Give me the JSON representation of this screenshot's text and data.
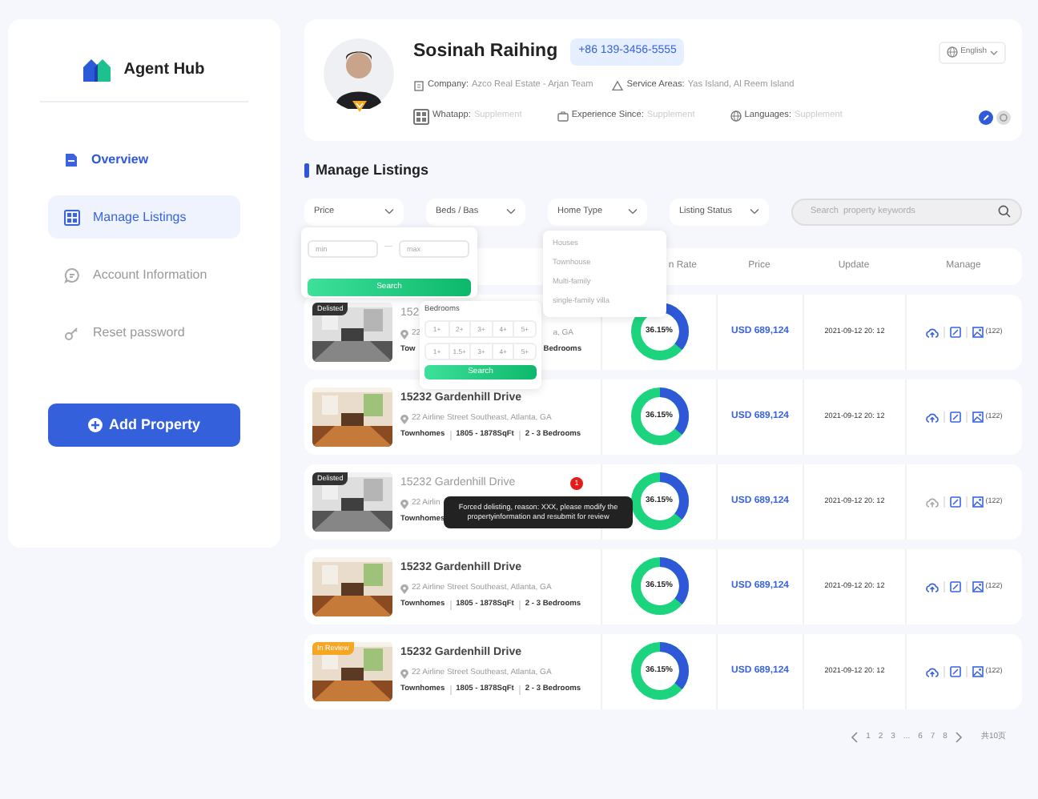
{
  "sidebar": {
    "logo": "Agent Hub",
    "items": [
      {
        "label": "Overview",
        "selected": false,
        "emphasized": true
      },
      {
        "label": "Manage Listings",
        "selected": true,
        "emphasized": false
      },
      {
        "label": "Account Information",
        "selected": false,
        "emphasized": false
      },
      {
        "label": "Reset password",
        "selected": false,
        "emphasized": false
      }
    ],
    "add_button": "Add Property"
  },
  "profile": {
    "name": "Sosinah Raihing",
    "phone": "+86 139-3456-5555",
    "language": "English",
    "fields": [
      {
        "label": "Company:",
        "value": "Azco Real Estate - Arjan Team",
        "filled": true
      },
      {
        "label": "Service Areas:",
        "value": "Yas Island, Al Reem Island",
        "filled": true
      },
      {
        "label": "Whatapp:",
        "value": "Supplement",
        "filled": false
      },
      {
        "label": "Experience Since:",
        "value": "Supplement",
        "filled": false
      },
      {
        "label": "Languages:",
        "value": "Supplement",
        "filled": false
      }
    ]
  },
  "section_title": "Manage Listings",
  "filters": [
    {
      "label": "Price"
    },
    {
      "label": "Beds / Bas"
    },
    {
      "label": "Home Type"
    },
    {
      "label": "Listing Status"
    }
  ],
  "search": {
    "placeholder": "Search  property keywords"
  },
  "price_popup": {
    "min_placeholder": "min",
    "separator": "—",
    "max_placeholder": "max",
    "button": "Search"
  },
  "beds_popup": {
    "title": "Bedrooms",
    "bedroom_options": [
      "1+",
      "2+",
      "3+",
      "4+",
      "5+"
    ],
    "bathroom_options": [
      "1+",
      "1.5+",
      "3+",
      "4+",
      "5+"
    ],
    "button": "Search"
  },
  "home_type_menu": [
    "Houses",
    "Townhouse",
    "Multi-family",
    "single-family villa"
  ],
  "table": {
    "columns": [
      "n Rate",
      "Price",
      "Update",
      "Manage"
    ],
    "rows": [
      {
        "status": {
          "kind": "delisted",
          "label": "Delisted"
        },
        "title": "152",
        "address": "22",
        "address_tail": "a, GA",
        "features": [
          "Tow"
        ],
        "features_tail": "Bedrooms",
        "rate": "36.15%",
        "level": 0.36,
        "price": "USD 689,124",
        "updated": "2021-09-12 20: 12",
        "count": "(122)",
        "upload_disabled": false
      },
      {
        "status": null,
        "title": "15232 Gardenhill Drive",
        "address": "22 Airline Street Southeast, Atlanta, GA",
        "features": [
          "Townhomes",
          "1805 - 1878SqFt",
          "2 - 3 Bedrooms"
        ],
        "rate": "36.15%",
        "level": 0.36,
        "price": "USD 689,124",
        "updated": "2021-09-12 20: 12",
        "count": "(122)",
        "upload_disabled": false
      },
      {
        "status": {
          "kind": "delisted",
          "label": "Delisted"
        },
        "title": "15232 Gardenhill Drive",
        "address": "22 Airlin",
        "features": [
          "Townhomes"
        ],
        "rate": "36.15%",
        "level": 0.36,
        "price": "USD 689,124",
        "updated": "2021-09-12 20: 12",
        "count": "(122)",
        "upload_disabled": true
      },
      {
        "status": null,
        "title": "15232 Gardenhill Drive",
        "address": "22 Airline Street Southeast, Atlanta, GA",
        "features": [
          "Townhomes",
          "1805 - 1878SqFt",
          "2 - 3 Bedrooms"
        ],
        "rate": "36.15%",
        "level": 0.36,
        "price": "USD 689,124",
        "updated": "2021-09-12 20: 12",
        "count": "(122)",
        "upload_disabled": false
      },
      {
        "status": {
          "kind": "review",
          "label": "In Review"
        },
        "title": "15232 Gardenhill Drive",
        "address": "22 Airline Street Southeast, Atlanta, GA",
        "features": [
          "Townhomes",
          "1805 - 1878SqFt",
          "2 - 3 Bedrooms"
        ],
        "rate": "36.15%",
        "level": 0.36,
        "price": "USD 689,124",
        "updated": "2021-09-12 20: 12",
        "count": "(122)",
        "upload_disabled": false
      }
    ]
  },
  "tooltip": {
    "badge": "1",
    "text": "Forced delisting, reason: XXX, please modify the propertyinformation and resubmit for review"
  },
  "pagination": {
    "pages": [
      "1",
      "2",
      "3",
      "...",
      "6",
      "7",
      "8"
    ],
    "total": "共10页"
  }
}
